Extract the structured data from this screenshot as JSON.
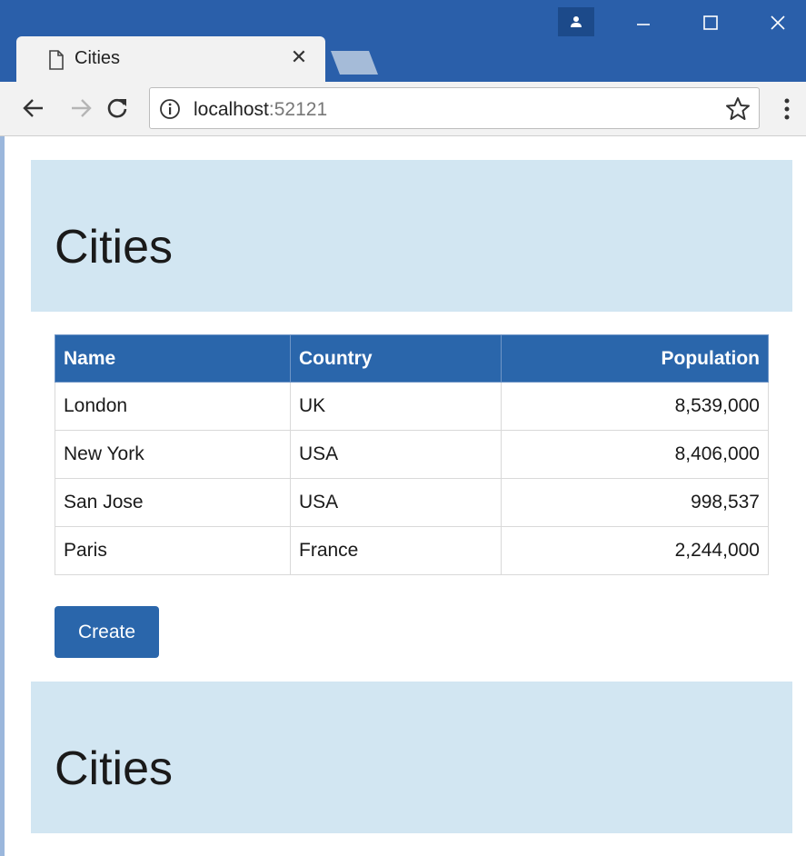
{
  "browser": {
    "tab_title": "Cities",
    "tab_close_glyph": "✕",
    "url_host": "localhost",
    "url_port": ":52121",
    "icons": {
      "tab": "page-icon",
      "profile": "person-icon",
      "minimize": "minimize-icon",
      "maximize": "maximize-icon",
      "close": "close-icon",
      "back": "back-arrow-icon",
      "forward": "forward-arrow-icon",
      "reload": "reload-icon",
      "info": "info-icon",
      "bookmark": "star-icon",
      "menu": "kebab-menu-icon"
    },
    "colors": {
      "titlebar": "#2a5faa",
      "toolbar": "#f2f2f2"
    }
  },
  "page": {
    "header_title": "Cities",
    "footer_title": "Cities",
    "table": {
      "headers": [
        "Name",
        "Country",
        "Population"
      ],
      "rows": [
        [
          "London",
          "UK",
          "8,539,000"
        ],
        [
          "New York",
          "USA",
          "8,406,000"
        ],
        [
          "San Jose",
          "USA",
          "998,537"
        ],
        [
          "Paris",
          "France",
          "2,244,000"
        ]
      ]
    },
    "create_label": "Create",
    "colors": {
      "jumbotron": "#d2e6f2",
      "primary": "#2a66ab"
    }
  }
}
